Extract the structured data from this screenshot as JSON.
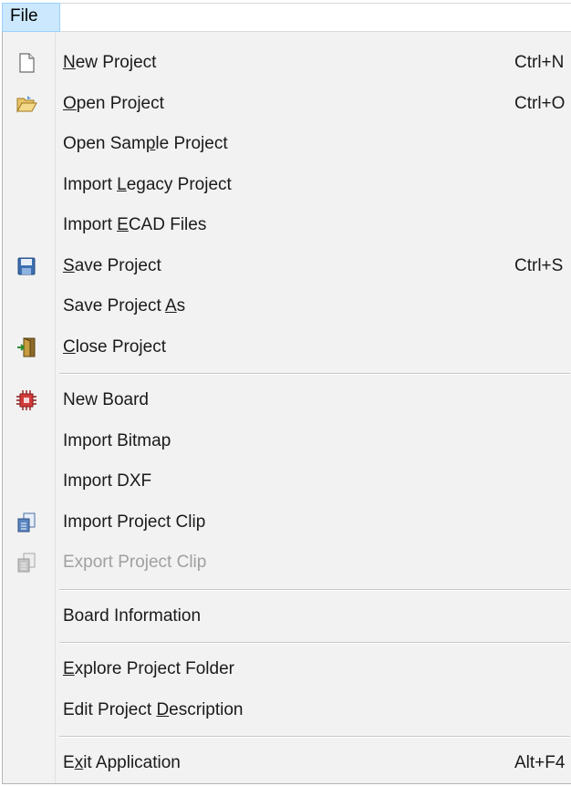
{
  "menubar": {
    "file_label": "File"
  },
  "menu": {
    "groups": [
      [
        {
          "label": "New Project",
          "mn": 0,
          "shortcut": "Ctrl+N",
          "icon": "new-file-icon"
        },
        {
          "label": "Open Project",
          "mn": 0,
          "shortcut": "Ctrl+O",
          "icon": "open-folder-icon"
        },
        {
          "label": "Open Sample Project",
          "mn": 8,
          "shortcut": "",
          "icon": ""
        },
        {
          "label": "Import Legacy Project",
          "mn": 7,
          "shortcut": "",
          "icon": ""
        },
        {
          "label": "Import ECAD Files",
          "mn": 7,
          "shortcut": "",
          "icon": ""
        },
        {
          "label": "Save Project",
          "mn": 0,
          "shortcut": "Ctrl+S",
          "icon": "save-floppy-icon"
        },
        {
          "label": "Save Project As",
          "mn": 13,
          "shortcut": "",
          "icon": ""
        },
        {
          "label": "Close Project",
          "mn": 0,
          "shortcut": "",
          "icon": "close-door-icon"
        }
      ],
      [
        {
          "label": "New Board",
          "mn": -1,
          "shortcut": "",
          "icon": "circuit-board-icon"
        },
        {
          "label": "Import Bitmap",
          "mn": -1,
          "shortcut": "",
          "icon": ""
        },
        {
          "label": "Import DXF",
          "mn": -1,
          "shortcut": "",
          "icon": ""
        },
        {
          "label": "Import Project Clip",
          "mn": -1,
          "shortcut": "",
          "icon": "import-clip-icon"
        },
        {
          "label": "Export Project Clip",
          "mn": -1,
          "shortcut": "",
          "icon": "export-clip-icon",
          "disabled": true
        }
      ],
      [
        {
          "label": "Board Information",
          "mn": -1,
          "shortcut": "",
          "icon": ""
        }
      ],
      [
        {
          "label": "Explore Project Folder",
          "mn": 0,
          "shortcut": "",
          "icon": ""
        },
        {
          "label": "Edit Project Description",
          "mn": 13,
          "shortcut": "",
          "icon": ""
        }
      ],
      [
        {
          "label": "Exit Application",
          "mn": 1,
          "shortcut": "Alt+F4",
          "icon": ""
        }
      ]
    ]
  }
}
